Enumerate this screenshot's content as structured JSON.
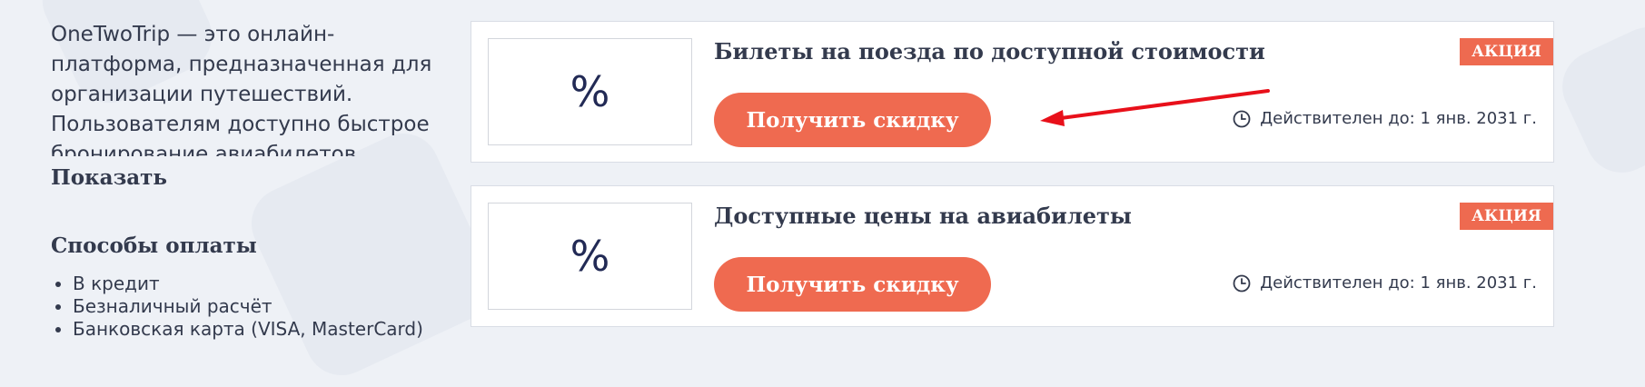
{
  "sidebar": {
    "description": "OneTwoTrip — это онлайн-платформа, предназначенная для организации путешествий. Пользователям доступно быстрое бронирование авиабилетов.",
    "show_label": "Показать",
    "payment_title": "Способы оплаты",
    "payment_methods": [
      "В кредит",
      "Безналичный расчёт",
      "Банковская карта (VISA, MasterCard)"
    ]
  },
  "coupons": [
    {
      "thumb_symbol": "%",
      "title": "Билеты на поезда по доступной стоимости",
      "badge": "АКЦИЯ",
      "button_label": "Получить скидку",
      "validity": "Действителен до: 1 янв. 2031 г."
    },
    {
      "thumb_symbol": "%",
      "title": "Доступные цены на авиабилеты",
      "badge": "АКЦИЯ",
      "button_label": "Получить скидку",
      "validity": "Действителен до: 1 янв. 2031 г."
    }
  ],
  "colors": {
    "accent": "#ef6a50",
    "page_background": "#eef1f6",
    "text": "#333a4d",
    "percent": "#222a55",
    "annotation_arrow": "#e8101a"
  },
  "icons": {
    "validity": "clock-icon",
    "annotation": "arrow-icon"
  }
}
